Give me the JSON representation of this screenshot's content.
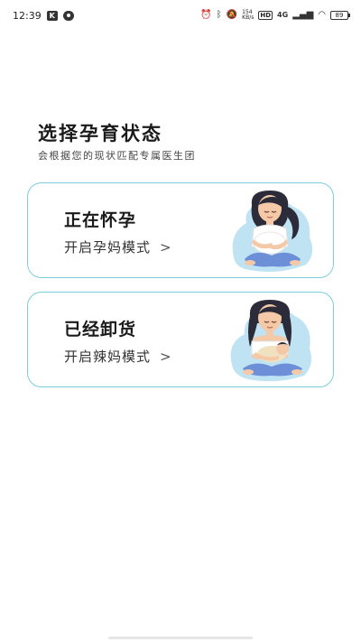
{
  "status_bar": {
    "time": "12:39",
    "app_badge_k": "K",
    "speed_top": "154",
    "speed_bottom": "KB/s",
    "hd": "HD",
    "network": "4G",
    "battery": "89"
  },
  "header": {
    "title": "选择孕育状态",
    "subtitle": "会根据您的现状匹配专属医生团"
  },
  "options": [
    {
      "title": "正在怀孕",
      "action": "开启孕妈模式",
      "chevron": ">"
    },
    {
      "title": "已经卸货",
      "action": "开启辣妈模式",
      "chevron": ">"
    }
  ],
  "colors": {
    "card_border": "#7ccfda",
    "skin": "#f4c9a8",
    "hair": "#2b2b3a",
    "pants": "#6c8fd8",
    "splash": "#bfe3f3"
  }
}
